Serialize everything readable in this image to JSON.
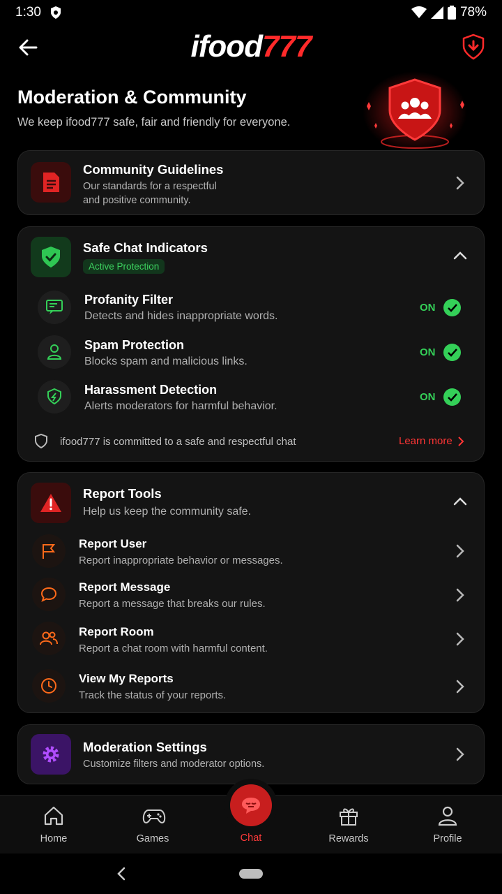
{
  "status_bar": {
    "time": "1:30",
    "battery": "78%"
  },
  "header": {
    "logo_main": "ifood",
    "logo_accent": "777"
  },
  "page": {
    "title": "Moderation & Community",
    "subtitle": "We keep ifood777 safe, fair and friendly for everyone."
  },
  "guidelines": {
    "title": "Community Guidelines",
    "desc_line1": "Our standards for a respectful",
    "desc_line2": "and positive community."
  },
  "safe_chat": {
    "title": "Safe Chat Indicators",
    "badge": "Active Protection",
    "items": [
      {
        "title": "Profanity Filter",
        "desc": "Detects and hides inappropriate words.",
        "status": "ON"
      },
      {
        "title": "Spam Protection",
        "desc": "Blocks spam and malicious links.",
        "status": "ON"
      },
      {
        "title": "Harassment Detection",
        "desc": "Alerts moderators for harmful behavior.",
        "status": "ON"
      }
    ],
    "footer_text": "ifood777 is committed to a safe and respectful chat",
    "learn_more": "Learn more"
  },
  "report_tools": {
    "title": "Report Tools",
    "subtitle": "Help us keep the community safe.",
    "items": [
      {
        "title": "Report User",
        "desc": "Report inappropriate behavior or messages."
      },
      {
        "title": "Report Message",
        "desc": "Report a message that breaks our rules."
      },
      {
        "title": "Report Room",
        "desc": "Report a chat room with harmful content."
      },
      {
        "title": "View My Reports",
        "desc": "Track the status of your reports."
      }
    ]
  },
  "moderation_settings": {
    "title": "Moderation Settings",
    "desc": "Customize filters and moderator options."
  },
  "bottom_nav": {
    "home": "Home",
    "games": "Games",
    "chat": "Chat",
    "rewards": "Rewards",
    "profile": "Profile"
  },
  "colors": {
    "accent": "#ff2a2a",
    "success": "#34d058",
    "orange": "#ff6a1a",
    "purple": "#a23bff"
  }
}
